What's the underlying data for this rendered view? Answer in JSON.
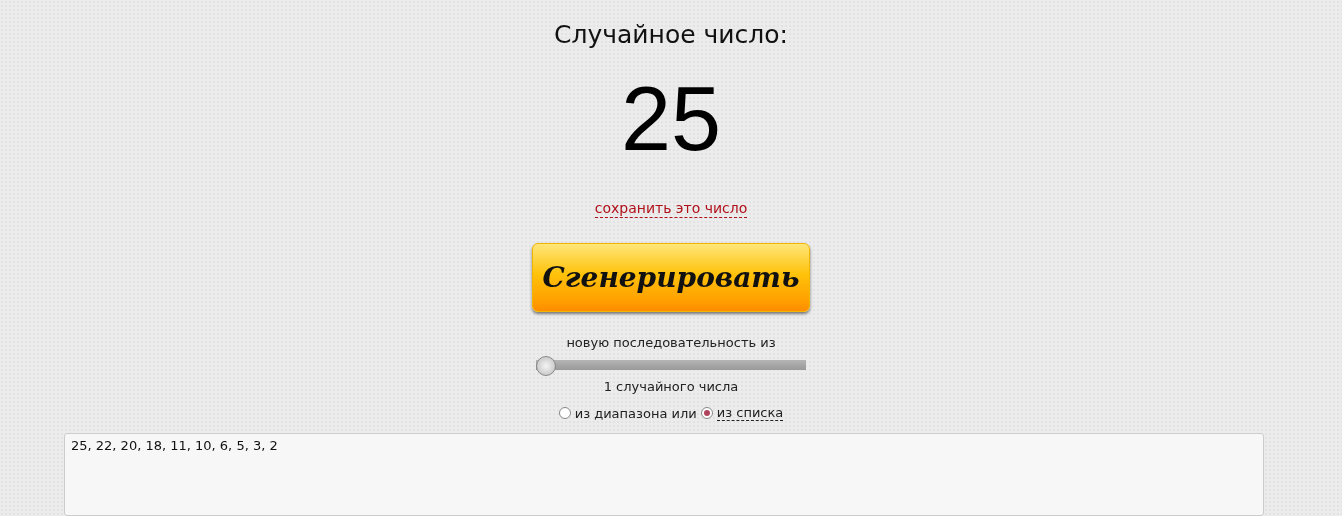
{
  "title": "Случайное число:",
  "result": "25",
  "save_link": "сохранить это число",
  "generate_button": "Сгенерировать",
  "sequence_label": "новую последовательность из",
  "count_slider": {
    "level": 0
  },
  "count_label": "1 случайного числа",
  "source_options": [
    {
      "label": "из диапазона или",
      "selected": false,
      "kind": "plain"
    },
    {
      "label": "из списка",
      "selected": true,
      "kind": "link"
    }
  ],
  "list_field": {
    "value": "25, 22, 20, 18, 11, 10, 6, 5, 3, 2"
  }
}
